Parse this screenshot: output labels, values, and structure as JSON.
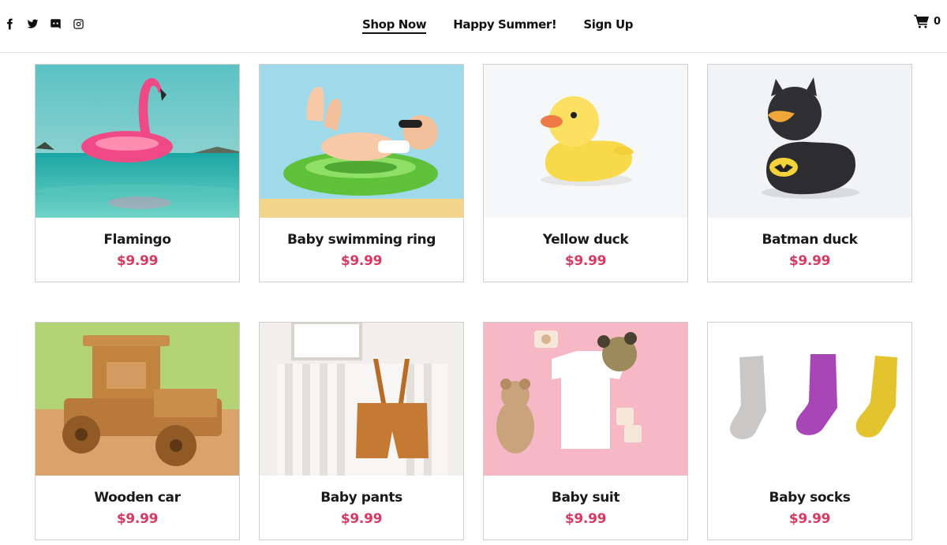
{
  "header": {
    "social": [
      {
        "icon": "facebook-icon"
      },
      {
        "icon": "twitter-icon"
      },
      {
        "icon": "discord-icon"
      },
      {
        "icon": "instagram-icon"
      }
    ],
    "nav": [
      {
        "label": "Shop Now",
        "active": true
      },
      {
        "label": "Happy Summer!",
        "active": false
      },
      {
        "label": "Sign Up",
        "active": false
      }
    ],
    "cart": {
      "icon": "cart-icon",
      "count": "0"
    }
  },
  "products": [
    {
      "name": "Flamingo",
      "price": "$9.99"
    },
    {
      "name": "Baby swimming ring",
      "price": "$9.99"
    },
    {
      "name": "Yellow duck",
      "price": "$9.99"
    },
    {
      "name": "Batman duck",
      "price": "$9.99"
    },
    {
      "name": "Wooden car",
      "price": "$9.99"
    },
    {
      "name": "Baby pants",
      "price": "$9.99"
    },
    {
      "name": "Baby suit",
      "price": "$9.99"
    },
    {
      "name": "Baby socks",
      "price": "$9.99"
    }
  ],
  "colors": {
    "price": "#d63a62",
    "border": "#cfcfcf"
  }
}
